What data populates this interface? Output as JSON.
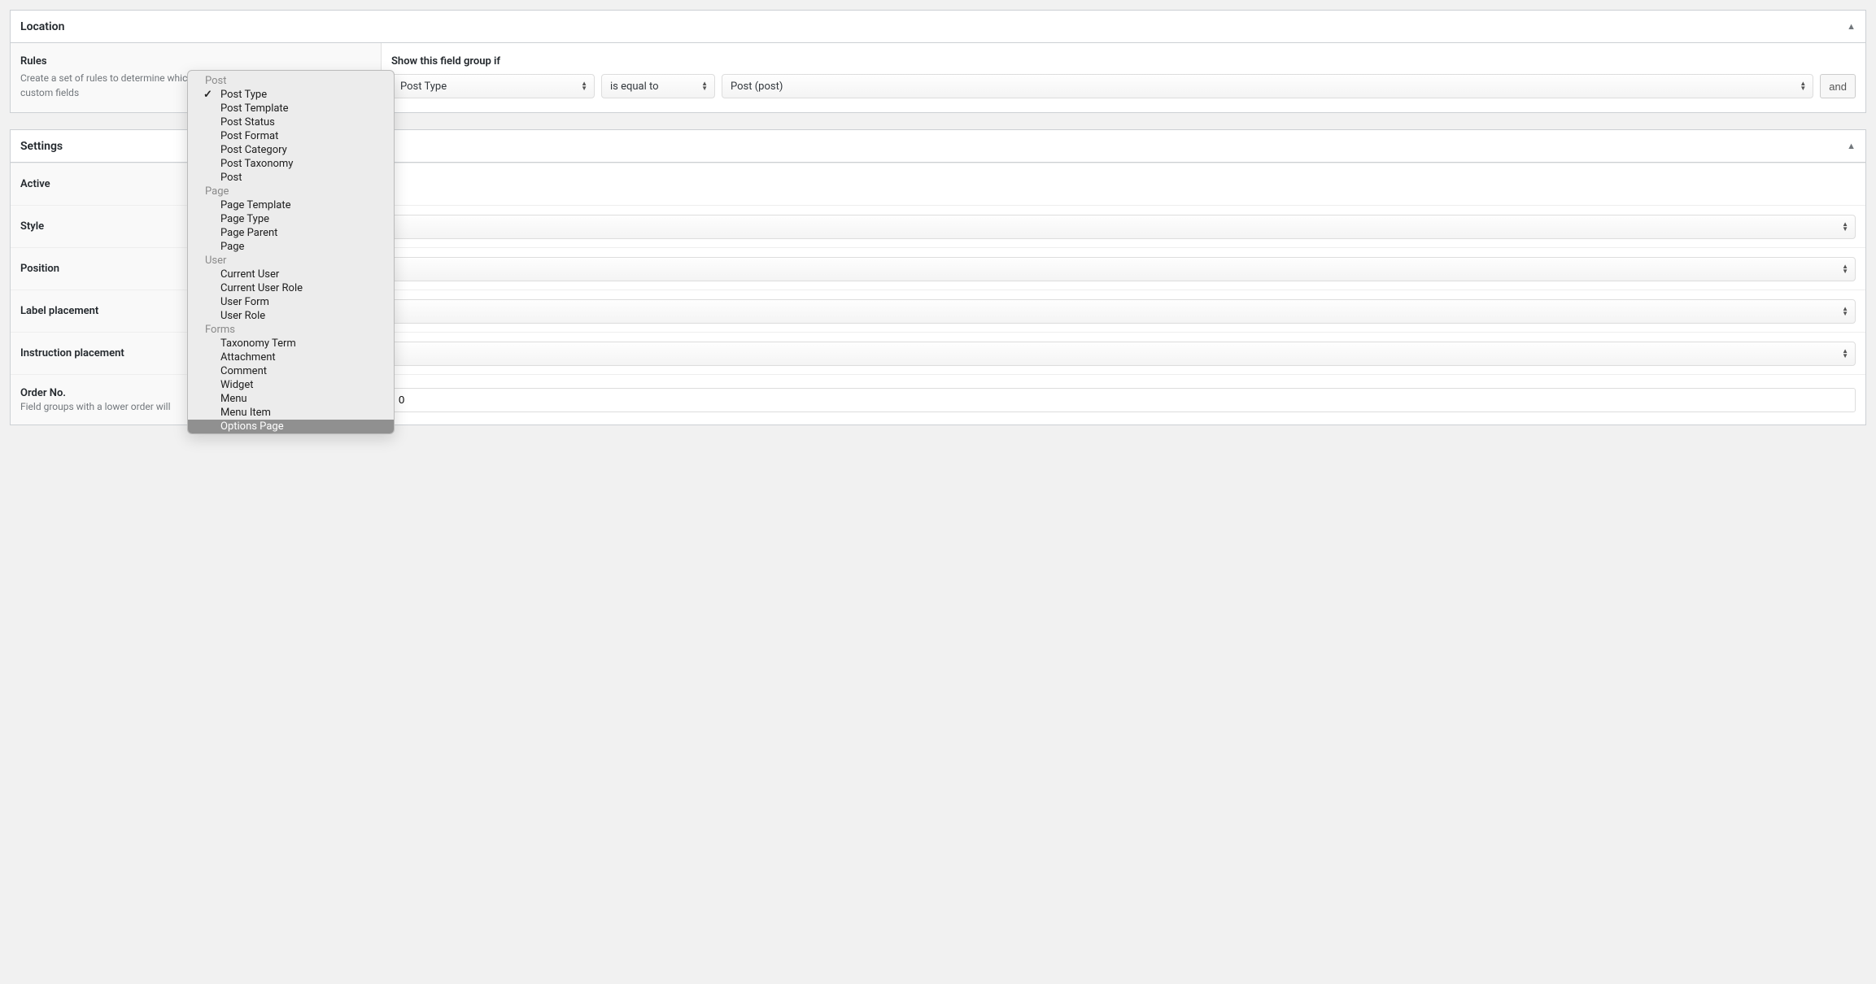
{
  "location": {
    "panel_title": "Location",
    "rules_label": "Rules",
    "rules_desc": "Create a set of rules to determine which edit screens will use these advanced custom fields",
    "prompt": "Show this field group if",
    "rule": {
      "param_value": "Post Type",
      "operator_value": "is equal to",
      "value_value": "Post (post)",
      "and_label": "and"
    },
    "dropdown": {
      "groups": [
        {
          "label": "Post",
          "items": [
            "Post Type",
            "Post Template",
            "Post Status",
            "Post Format",
            "Post Category",
            "Post Taxonomy",
            "Post"
          ]
        },
        {
          "label": "Page",
          "items": [
            "Page Template",
            "Page Type",
            "Page Parent",
            "Page"
          ]
        },
        {
          "label": "User",
          "items": [
            "Current User",
            "Current User Role",
            "User Form",
            "User Role"
          ]
        },
        {
          "label": "Forms",
          "items": [
            "Taxonomy Term",
            "Attachment",
            "Comment",
            "Widget",
            "Menu",
            "Menu Item",
            "Options Page"
          ]
        }
      ],
      "selected": "Post Type",
      "highlighted": "Options Page"
    }
  },
  "settings": {
    "panel_title": "Settings",
    "rows": {
      "active_label": "Active",
      "style_label": "Style",
      "position_label": "Position",
      "label_placement_label": "Label placement",
      "instruction_placement_label": "Instruction placement",
      "order_no_label": "Order No.",
      "order_no_desc": "Field groups with a lower order will",
      "order_no_value": "0"
    }
  }
}
